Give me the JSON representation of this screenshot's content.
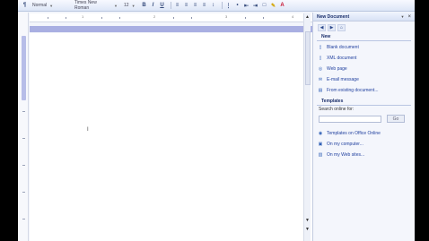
{
  "toolbar": {
    "style_value": "Normal",
    "font_value": "Times New Roman",
    "size_value": "12",
    "bold_label": "B",
    "italic_label": "I",
    "underline_label": "U"
  },
  "ruler": {
    "numbers": [
      "1",
      "2",
      "3",
      "4"
    ]
  },
  "document": {
    "cursor_glyph": "I"
  },
  "task_pane": {
    "title": "New Document",
    "close_glyph": "×",
    "sections": {
      "new": "New",
      "templates": "Templates"
    },
    "new_items": [
      {
        "label": "Blank document",
        "icon": "blank-document-icon"
      },
      {
        "label": "XML document",
        "icon": "xml-document-icon"
      },
      {
        "label": "Web page",
        "icon": "web-page-icon"
      },
      {
        "label": "E-mail message",
        "icon": "email-icon"
      },
      {
        "label": "From existing document...",
        "icon": "existing-document-icon"
      }
    ],
    "search_label": "Search online for:",
    "search_value": "",
    "go_label": "Go",
    "template_items": [
      {
        "label": "Templates on Office Online",
        "icon": "globe-icon"
      },
      {
        "label": "On my computer...",
        "icon": "computer-icon"
      },
      {
        "label": "On my Web sites...",
        "icon": "web-sites-icon"
      }
    ]
  },
  "colors": {
    "toolbar_top": "#f7f9ff",
    "toolbar_bottom": "#dde6f7",
    "selection_bar": "#a9afe2",
    "link_blue": "#1f3f9e",
    "pane_title": "#1b2f6b"
  }
}
